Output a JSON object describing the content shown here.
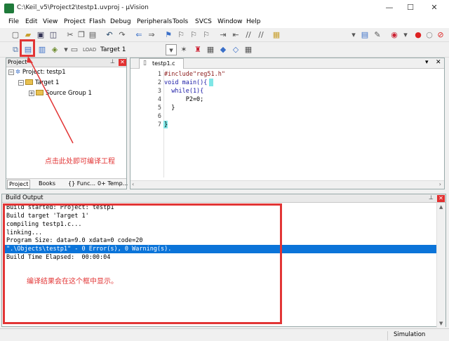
{
  "window": {
    "title": "C:\\Keil_v5\\Project2\\testp1.uvproj - µVision",
    "controls": {
      "minimize": "—",
      "maximize": "☐",
      "close": "✕"
    }
  },
  "menu": [
    "File",
    "Edit",
    "View",
    "Project",
    "Flash",
    "Debug",
    "Peripherals",
    "Tools",
    "SVCS",
    "Window",
    "Help"
  ],
  "toolbar2": {
    "target": "Target 1"
  },
  "project_panel": {
    "title": "Project",
    "tree": {
      "root": "Project: testp1",
      "target": "Target 1",
      "group": "Source Group 1"
    },
    "tabs": [
      "Project",
      "Books",
      "{} Func...",
      "0+ Temp..."
    ]
  },
  "editor": {
    "tab": "testp1.c",
    "lines": [
      {
        "num": "1",
        "code": "#include\"reg51.h\""
      },
      {
        "num": "2",
        "code": "void main(){"
      },
      {
        "num": "3",
        "code": "  while(1){"
      },
      {
        "num": "4",
        "code": "      P2=0;"
      },
      {
        "num": "5",
        "code": "  }"
      },
      {
        "num": "6",
        "code": ""
      },
      {
        "num": "7",
        "code": "}"
      }
    ]
  },
  "build_output": {
    "title": "Build Output",
    "lines": [
      "Build started: Project: testp1",
      "Build target 'Target 1'",
      "compiling testp1.c...",
      "linking...",
      "Program Size: data=9.0 xdata=0 code=20",
      "\".\\Objects\\testp1\" - 0 Error(s), 0 Warning(s).",
      "Build Time Elapsed:  00:00:04"
    ],
    "highlighted_line": 5
  },
  "status": {
    "mode": "Simulation"
  },
  "annotations": {
    "compile_hint": "点击此处即可编译工程",
    "result_hint": "编译结果会在这个框中显示。"
  },
  "colors": {
    "annotation": "#e23535",
    "highlight": "#0b74d9",
    "keyword": "#1a1aa6",
    "preproc": "#8b1a1a"
  }
}
